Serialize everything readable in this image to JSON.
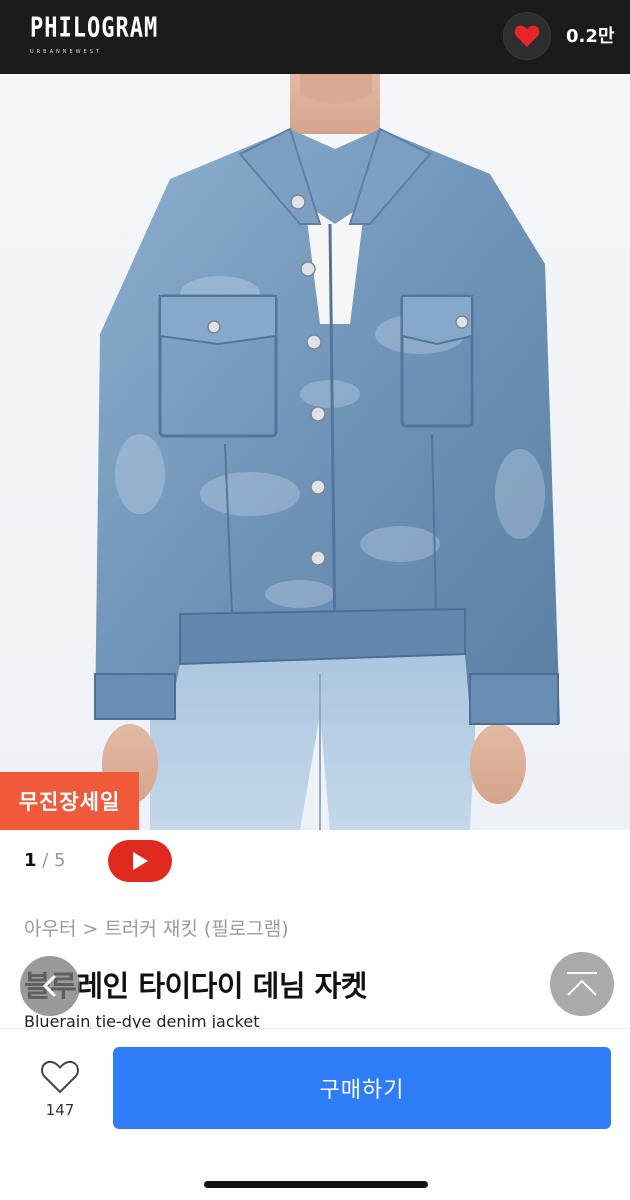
{
  "header": {
    "logo_text": "PHILOGRAM",
    "logo_subtext": "URBANNEWEST",
    "wish_count": "0.2만"
  },
  "product_image": {
    "description_icon": "denim-jacket-photo",
    "sale_badge": "무진장세일"
  },
  "pager": {
    "current": "1",
    "separator": " / ",
    "total": "5"
  },
  "product": {
    "breadcrumb": "아우터 > 트러커 재킷 (필로그램)",
    "title": "블루레인 타이다이 데님 자켓",
    "subtitle": "Bluerain tie-dye denim jacket"
  },
  "bottom_bar": {
    "like_count": "147",
    "buy_label": "구매하기"
  },
  "colors": {
    "accent": "#2f7df6",
    "sale": "#f0593a",
    "video": "#e02a1f",
    "header_bg": "#1b1b1b"
  }
}
